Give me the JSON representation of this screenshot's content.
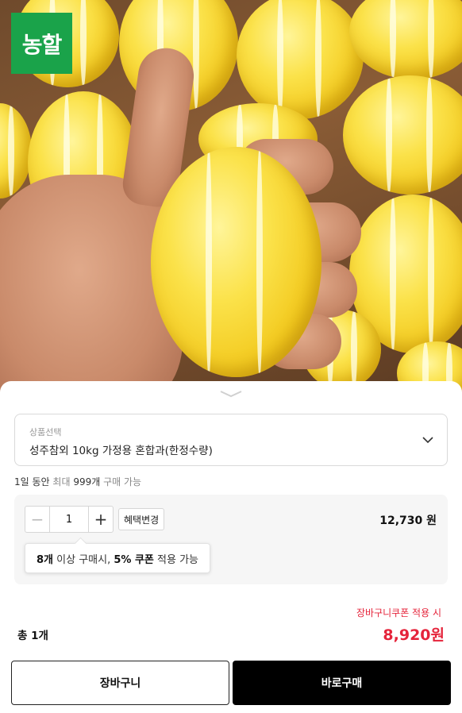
{
  "brand": {
    "logo_text": "농할",
    "logo_color": "#1aa34a"
  },
  "product_select": {
    "label": "상품선택",
    "value": "성주참외 10kg 가정용 혼합과(한정수량)"
  },
  "purchase_limit": {
    "prefix": "1일 동안",
    "mid": "최대",
    "count": "999개",
    "suffix": "구매 가능"
  },
  "option": {
    "quantity": "1",
    "minus_symbol": "−",
    "plus_symbol": "+",
    "benefit_button": "혜택변경",
    "price": "12,730 원",
    "tooltip": {
      "qty": "8개",
      "text1": " 이상 구매시, ",
      "pct": "5% 쿠폰",
      "text2": " 적용 가능"
    }
  },
  "summary": {
    "coupon_note": "장바구니쿠폰 적용 시",
    "total_label": "총 1개",
    "final_price": "8,920원"
  },
  "actions": {
    "cart_label": "장바구니",
    "buy_label": "바로구매"
  },
  "colors": {
    "accent_red": "#e5243b",
    "buy_bg": "#000000"
  }
}
